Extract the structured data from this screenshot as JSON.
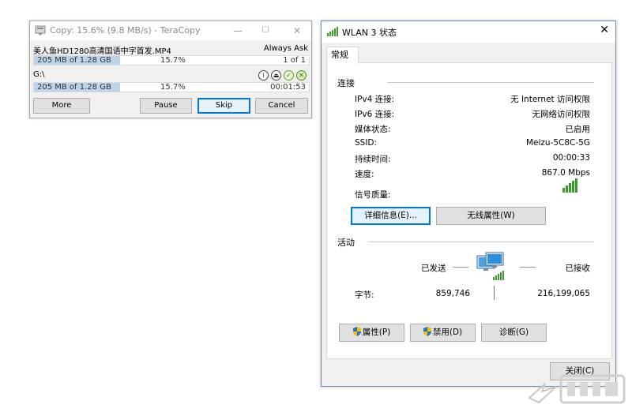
{
  "teracopy": {
    "title": "Copy: 15.6%  (9.8 MB/s) - TeraCopy",
    "file_name": "美人鱼HD1280高清国语中字首发.MP4",
    "conflict_mode": "Always Ask",
    "file_progress": {
      "copied": "205 MB of 1.28 GB",
      "percent_text": "15.7%",
      "count": "1 of 1",
      "fraction": 0.157
    },
    "target": "G:\\",
    "total_progress": {
      "copied": "205 MB of 1.28 GB",
      "percent_text": "15.7%",
      "time": "00:01:53",
      "fraction": 0.157
    },
    "buttons": {
      "more": "More",
      "pause": "Pause",
      "skip": "Skip",
      "cancel": "Cancel"
    },
    "icons": [
      "info-icon",
      "eject-icon",
      "verify-icon",
      "close-when-done-icon"
    ]
  },
  "wlan": {
    "title": "WLAN 3 状态",
    "tab": "常规",
    "connection": {
      "title": "连接",
      "rows": [
        {
          "key": "IPv4 连接:",
          "value": "无 Internet 访问权限"
        },
        {
          "key": "IPv6 连接:",
          "value": "无网络访问权限"
        },
        {
          "key": "媒体状态:",
          "value": "已启用"
        },
        {
          "key": "SSID:",
          "value": "Meizu-5C8C-5G"
        },
        {
          "key": "持续时间:",
          "value": "00:00:33"
        },
        {
          "key": "速度:",
          "value": "867.0 Mbps"
        }
      ],
      "signal_label": "信号质量:",
      "signal_bars": 5
    },
    "details_button": "详细信息(E)...",
    "wireless_button": "无线属性(W)",
    "activity": {
      "title": "活动",
      "sent_label": "已发送",
      "received_label": "已接收",
      "bytes_label": "字节:",
      "bytes_sent": "859,746",
      "bytes_received": "216,199,065"
    },
    "buttons": {
      "properties": "属性(P)",
      "disable": "禁用(D)",
      "diagnose": "诊断(G)",
      "close": "关闭(C)"
    },
    "colors": {
      "signal_green": "#3a9a2a",
      "focus_blue": "#0078d7"
    }
  }
}
